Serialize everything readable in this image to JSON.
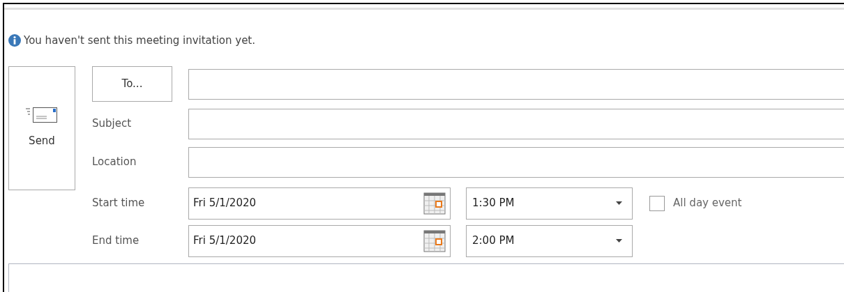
{
  "info_bar": {
    "message": "You haven't sent this meeting invitation yet."
  },
  "send_button": {
    "label": "Send"
  },
  "to_button": {
    "label": "To..."
  },
  "fields": [
    {
      "label": "Subject"
    },
    {
      "label": "Location"
    }
  ],
  "times": [
    {
      "label": "Start time",
      "date": "Fri 5/1/2020",
      "time": "1:30 PM"
    },
    {
      "label": "End time",
      "date": "Fri 5/1/2020",
      "time": "2:00 PM"
    }
  ],
  "all_day_event": {
    "label": "All day event",
    "checked": false
  }
}
